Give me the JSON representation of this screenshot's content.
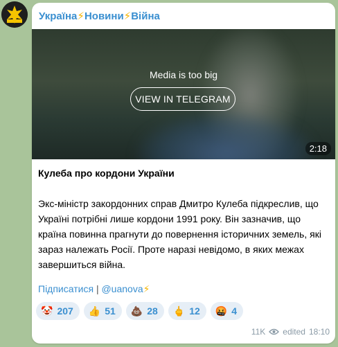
{
  "channel": {
    "name_parts": [
      "Україна",
      "Новини",
      "Війна"
    ],
    "bolt": "⚡",
    "avatar_icon": "ukraine-news-avatar-icon"
  },
  "media": {
    "notice": "Media is too big",
    "button_label": "VIEW IN TELEGRAM",
    "duration": "2:18"
  },
  "post": {
    "title": "Кулеба про кордони України",
    "body": "Экс-міністр закордонних справ Дмитро Кулеба підкреслив, що Україні потрібні лише кордони 1991 року. Він зазначив, що країна повинна прагнути до повернення історичних земель, які зараз належать Росії. Проте наразі невідомо, в яких межах завершиться війна."
  },
  "links": {
    "subscribe": "Підписатися",
    "separator": "|",
    "handle": "@uanova",
    "handle_suffix": "⚡"
  },
  "reactions": [
    {
      "emoji": "🤡",
      "count": "207"
    },
    {
      "emoji": "👍",
      "count": "51"
    },
    {
      "emoji": "💩",
      "count": "28"
    },
    {
      "emoji": "🖕",
      "count": "12"
    },
    {
      "emoji": "🤬",
      "count": "4"
    }
  ],
  "meta": {
    "views": "11K",
    "views_icon": "eye-icon",
    "edited_label": "edited",
    "time": "18:10"
  },
  "colors": {
    "link": "#3a8fd0",
    "bolt": "#f5b400",
    "background": "#a9c49a"
  }
}
